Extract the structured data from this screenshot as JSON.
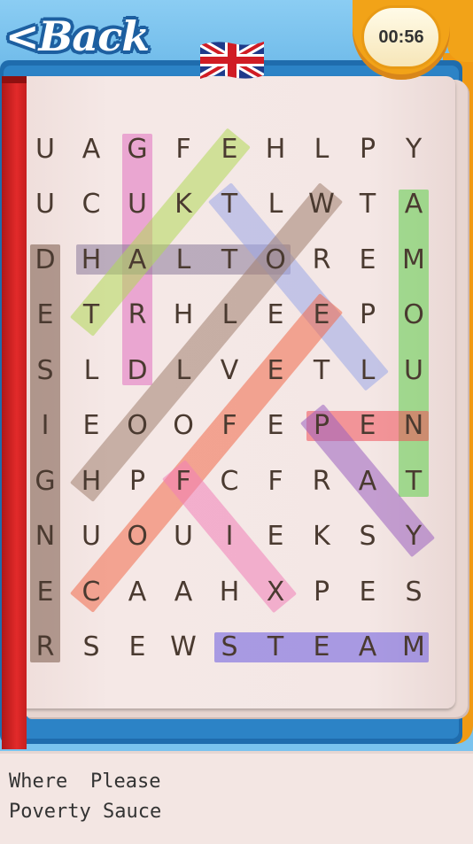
{
  "header": {
    "back_label": "<Back",
    "timer": "00:56",
    "language_flag": "uk-flag-icon"
  },
  "grid": {
    "rows": [
      [
        "U",
        "A",
        "G",
        "F",
        "E",
        "H",
        "L",
        "P",
        "Y"
      ],
      [
        "U",
        "C",
        "U",
        "K",
        "T",
        "L",
        "W",
        "T",
        "A"
      ],
      [
        "D",
        "H",
        "A",
        "L",
        "T",
        "O",
        "R",
        "E",
        "M"
      ],
      [
        "E",
        "T",
        "R",
        "H",
        "L",
        "E",
        "E",
        "P",
        "O"
      ],
      [
        "S",
        "L",
        "D",
        "L",
        "V",
        "E",
        "T",
        "L",
        "U"
      ],
      [
        "I",
        "E",
        "O",
        "O",
        "F",
        "E",
        "P",
        "E",
        "N"
      ],
      [
        "G",
        "H",
        "P",
        "F",
        "C",
        "F",
        "R",
        "A",
        "T"
      ],
      [
        "N",
        "U",
        "O",
        "U",
        "I",
        "E",
        "K",
        "S",
        "Y"
      ],
      [
        "E",
        "C",
        "A",
        "A",
        "H",
        "X",
        "P",
        "E",
        "S"
      ],
      [
        "R",
        "S",
        "E",
        "W",
        "S",
        "T",
        "E",
        "A",
        "M"
      ]
    ]
  },
  "found_words": [
    {
      "word": "DESIGNER",
      "from": [
        2,
        0
      ],
      "to": [
        9,
        0
      ],
      "color": "#7a5a48"
    },
    {
      "word": "GUARD",
      "from": [
        0,
        2
      ],
      "to": [
        4,
        2
      ],
      "color": "#e070c0"
    },
    {
      "word": "AMOUNT",
      "from": [
        1,
        8
      ],
      "to": [
        6,
        8
      ],
      "color": "#5fd04a"
    },
    {
      "word": "HALTO",
      "from": [
        2,
        1
      ],
      "to": [
        2,
        5
      ],
      "color": "#8a7a9a"
    },
    {
      "word": "PEN",
      "from": [
        5,
        6
      ],
      "to": [
        5,
        8
      ],
      "color": "#f0505a"
    },
    {
      "word": "STEAM",
      "from": [
        9,
        4
      ],
      "to": [
        9,
        8
      ],
      "color": "#6a5ae0"
    },
    {
      "word": "ETKE",
      "from": [
        3,
        1
      ],
      "to": [
        0,
        4
      ],
      "color": "#b0d858"
    },
    {
      "word": "TLEE",
      "from": [
        1,
        4
      ],
      "to": [
        4,
        7
      ],
      "color": "#9aa8e8"
    },
    {
      "word": "DIAG1",
      "from": [
        6,
        1
      ],
      "to": [
        1,
        6
      ],
      "color": "#a08070"
    },
    {
      "word": "CAPE",
      "from": [
        8,
        1
      ],
      "to": [
        3,
        6
      ],
      "color": "#f06a4a"
    },
    {
      "word": "FIX",
      "from": [
        6,
        3
      ],
      "to": [
        8,
        5
      ],
      "color": "#f080b8"
    },
    {
      "word": "PRSY",
      "from": [
        5,
        6
      ],
      "to": [
        7,
        8
      ],
      "color": "#9a60c0"
    }
  ],
  "word_list": [
    "Where",
    "Please",
    "Poverty",
    "Sauce"
  ]
}
